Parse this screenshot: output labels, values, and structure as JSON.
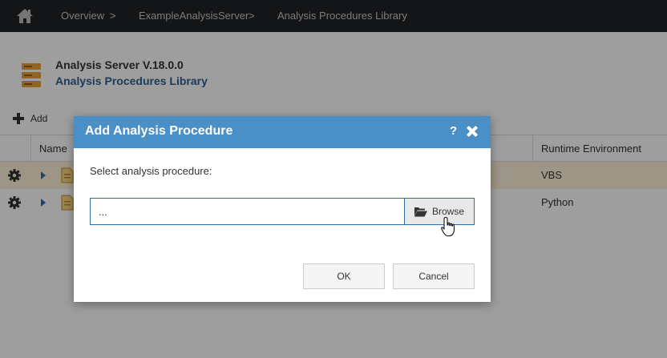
{
  "breadcrumb": {
    "items": [
      "Overview",
      "ExampleAnalysisServer",
      "Analysis Procedures Library"
    ],
    "separator": ">"
  },
  "server": {
    "title": "Analysis Server V.18.0.0",
    "subtitle": "Analysis Procedures Library"
  },
  "toolbar": {
    "add_label": "Add"
  },
  "table": {
    "columns": [
      "Name",
      "Runtime Environment"
    ],
    "rows": [
      {
        "runtime": "VBS",
        "selected": true
      },
      {
        "runtime": "Python",
        "selected": false
      }
    ]
  },
  "dialog": {
    "title": "Add Analysis Procedure",
    "help_label": "?",
    "label": "Select analysis procedure:",
    "path_value": "...",
    "browse_label": "Browse",
    "ok_label": "OK",
    "cancel_label": "Cancel"
  },
  "icons": {
    "home": "home-icon",
    "server": "server-icon",
    "add": "plus-icon",
    "row_settings": "gear-icon",
    "expand": "expand-icon",
    "file": "script-file-icon",
    "help": "help-icon",
    "close": "close-icon",
    "folder": "folder-open-icon",
    "cursor": "hand-cursor-icon"
  },
  "colors": {
    "topbar": "#202226",
    "dialog_header": "#4a8fc6",
    "link": "#2f5f91",
    "selected_row": "#fdf3da",
    "server_icon": "#e8a33a"
  }
}
